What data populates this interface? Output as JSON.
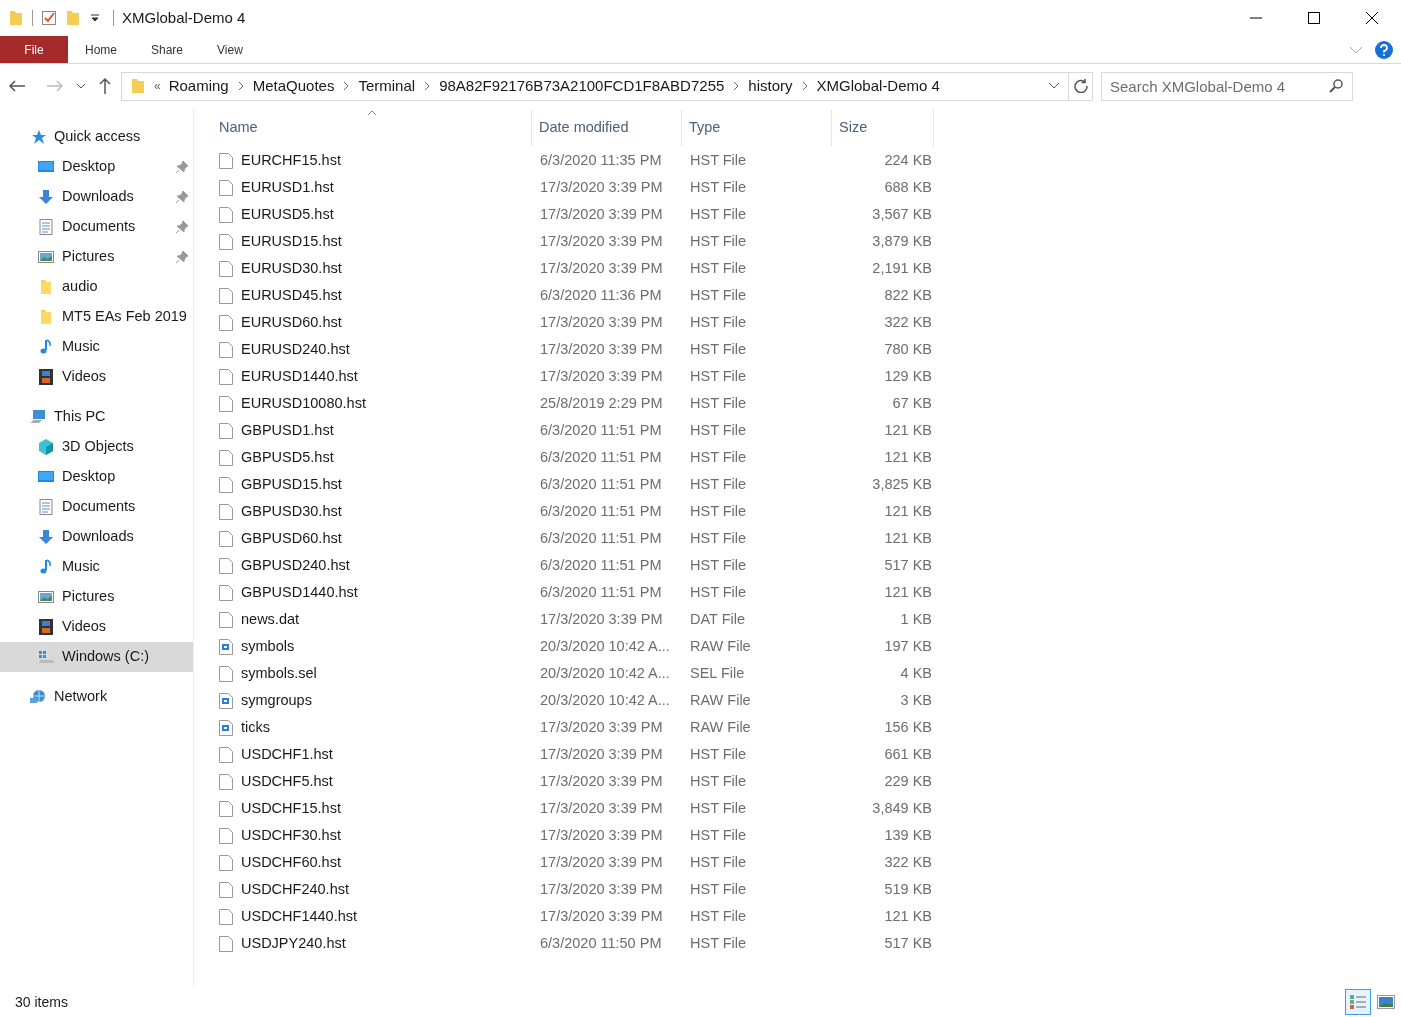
{
  "window": {
    "title": "XMGlobal-Demo 4"
  },
  "ribbon_tabs": [
    {
      "label": "File",
      "kind": "file"
    },
    {
      "label": "Home",
      "kind": "tab"
    },
    {
      "label": "Share",
      "kind": "tab"
    },
    {
      "label": "View",
      "kind": "tab"
    }
  ],
  "address": {
    "overflow": "«",
    "segments": [
      "Roaming",
      "MetaQuotes",
      "Terminal",
      "98A82F92176B73A2100FCD1F8ABD7255",
      "history",
      "XMGlobal-Demo 4"
    ]
  },
  "search": {
    "placeholder": "Search XMGlobal-Demo 4"
  },
  "sidebar": [
    {
      "label": "Quick access",
      "kind": "star",
      "selected": false,
      "children": [
        {
          "label": "Desktop",
          "kind": "desktop",
          "pinned": true,
          "selected": false
        },
        {
          "label": "Downloads",
          "kind": "download",
          "pinned": true,
          "selected": false
        },
        {
          "label": "Documents",
          "kind": "document",
          "pinned": true,
          "selected": false
        },
        {
          "label": "Pictures",
          "kind": "picture",
          "pinned": true,
          "selected": false
        },
        {
          "label": "audio",
          "kind": "folder",
          "pinned": false,
          "selected": false
        },
        {
          "label": "MT5 EAs Feb 2019",
          "kind": "folder",
          "pinned": false,
          "selected": false
        },
        {
          "label": "Music",
          "kind": "music",
          "pinned": false,
          "selected": false
        },
        {
          "label": "Videos",
          "kind": "video",
          "pinned": false,
          "selected": false
        }
      ]
    },
    {
      "label": "This PC",
      "kind": "pc",
      "selected": false,
      "children": [
        {
          "label": "3D Objects",
          "kind": "cube",
          "pinned": false,
          "selected": false
        },
        {
          "label": "Desktop",
          "kind": "desktop",
          "pinned": false,
          "selected": false
        },
        {
          "label": "Documents",
          "kind": "document",
          "pinned": false,
          "selected": false
        },
        {
          "label": "Downloads",
          "kind": "download",
          "pinned": false,
          "selected": false
        },
        {
          "label": "Music",
          "kind": "music",
          "pinned": false,
          "selected": false
        },
        {
          "label": "Pictures",
          "kind": "picture",
          "pinned": false,
          "selected": false
        },
        {
          "label": "Videos",
          "kind": "video",
          "pinned": false,
          "selected": false
        },
        {
          "label": "Windows (C:)",
          "kind": "drive",
          "pinned": false,
          "selected": true
        }
      ]
    },
    {
      "label": "Network",
      "kind": "network",
      "selected": false
    }
  ],
  "table": {
    "columns": [
      {
        "label": "Name",
        "sorted": true
      },
      {
        "label": "Date modified",
        "sorted": false
      },
      {
        "label": "Type",
        "sorted": false
      },
      {
        "label": "Size",
        "sorted": false
      }
    ],
    "rows": [
      {
        "name": "EURCHF15.hst",
        "date": "6/3/2020 11:35 PM",
        "type": "HST File",
        "size": "224 KB",
        "kind": "file"
      },
      {
        "name": "EURUSD1.hst",
        "date": "17/3/2020 3:39 PM",
        "type": "HST File",
        "size": "688 KB",
        "kind": "file"
      },
      {
        "name": "EURUSD5.hst",
        "date": "17/3/2020 3:39 PM",
        "type": "HST File",
        "size": "3,567 KB",
        "kind": "file"
      },
      {
        "name": "EURUSD15.hst",
        "date": "17/3/2020 3:39 PM",
        "type": "HST File",
        "size": "3,879 KB",
        "kind": "file"
      },
      {
        "name": "EURUSD30.hst",
        "date": "17/3/2020 3:39 PM",
        "type": "HST File",
        "size": "2,191 KB",
        "kind": "file"
      },
      {
        "name": "EURUSD45.hst",
        "date": "6/3/2020 11:36 PM",
        "type": "HST File",
        "size": "822 KB",
        "kind": "file"
      },
      {
        "name": "EURUSD60.hst",
        "date": "17/3/2020 3:39 PM",
        "type": "HST File",
        "size": "322 KB",
        "kind": "file"
      },
      {
        "name": "EURUSD240.hst",
        "date": "17/3/2020 3:39 PM",
        "type": "HST File",
        "size": "780 KB",
        "kind": "file"
      },
      {
        "name": "EURUSD1440.hst",
        "date": "17/3/2020 3:39 PM",
        "type": "HST File",
        "size": "129 KB",
        "kind": "file"
      },
      {
        "name": "EURUSD10080.hst",
        "date": "25/8/2019 2:29 PM",
        "type": "HST File",
        "size": "67 KB",
        "kind": "file"
      },
      {
        "name": "GBPUSD1.hst",
        "date": "6/3/2020 11:51 PM",
        "type": "HST File",
        "size": "121 KB",
        "kind": "file"
      },
      {
        "name": "GBPUSD5.hst",
        "date": "6/3/2020 11:51 PM",
        "type": "HST File",
        "size": "121 KB",
        "kind": "file"
      },
      {
        "name": "GBPUSD15.hst",
        "date": "6/3/2020 11:51 PM",
        "type": "HST File",
        "size": "3,825 KB",
        "kind": "file"
      },
      {
        "name": "GBPUSD30.hst",
        "date": "6/3/2020 11:51 PM",
        "type": "HST File",
        "size": "121 KB",
        "kind": "file"
      },
      {
        "name": "GBPUSD60.hst",
        "date": "6/3/2020 11:51 PM",
        "type": "HST File",
        "size": "121 KB",
        "kind": "file"
      },
      {
        "name": "GBPUSD240.hst",
        "date": "6/3/2020 11:51 PM",
        "type": "HST File",
        "size": "517 KB",
        "kind": "file"
      },
      {
        "name": "GBPUSD1440.hst",
        "date": "6/3/2020 11:51 PM",
        "type": "HST File",
        "size": "121 KB",
        "kind": "file"
      },
      {
        "name": "news.dat",
        "date": "17/3/2020 3:39 PM",
        "type": "DAT File",
        "size": "1 KB",
        "kind": "file"
      },
      {
        "name": "symbols",
        "date": "20/3/2020 10:42 A...",
        "type": "RAW File",
        "size": "197 KB",
        "kind": "image"
      },
      {
        "name": "symbols.sel",
        "date": "20/3/2020 10:42 A...",
        "type": "SEL File",
        "size": "4 KB",
        "kind": "file"
      },
      {
        "name": "symgroups",
        "date": "20/3/2020 10:42 A...",
        "type": "RAW File",
        "size": "3 KB",
        "kind": "image"
      },
      {
        "name": "ticks",
        "date": "17/3/2020 3:39 PM",
        "type": "RAW File",
        "size": "156 KB",
        "kind": "image"
      },
      {
        "name": "USDCHF1.hst",
        "date": "17/3/2020 3:39 PM",
        "type": "HST File",
        "size": "661 KB",
        "kind": "file"
      },
      {
        "name": "USDCHF5.hst",
        "date": "17/3/2020 3:39 PM",
        "type": "HST File",
        "size": "229 KB",
        "kind": "file"
      },
      {
        "name": "USDCHF15.hst",
        "date": "17/3/2020 3:39 PM",
        "type": "HST File",
        "size": "3,849 KB",
        "kind": "file"
      },
      {
        "name": "USDCHF30.hst",
        "date": "17/3/2020 3:39 PM",
        "type": "HST File",
        "size": "139 KB",
        "kind": "file"
      },
      {
        "name": "USDCHF60.hst",
        "date": "17/3/2020 3:39 PM",
        "type": "HST File",
        "size": "322 KB",
        "kind": "file"
      },
      {
        "name": "USDCHF240.hst",
        "date": "17/3/2020 3:39 PM",
        "type": "HST File",
        "size": "519 KB",
        "kind": "file"
      },
      {
        "name": "USDCHF1440.hst",
        "date": "17/3/2020 3:39 PM",
        "type": "HST File",
        "size": "121 KB",
        "kind": "file"
      },
      {
        "name": "USDJPY240.hst",
        "date": "6/3/2020 11:50 PM",
        "type": "HST File",
        "size": "517 KB",
        "kind": "file"
      }
    ]
  },
  "status_bar": {
    "count": "30 items",
    "views": [
      {
        "kind": "details",
        "selected": true
      },
      {
        "kind": "large-icons",
        "selected": false
      }
    ]
  }
}
